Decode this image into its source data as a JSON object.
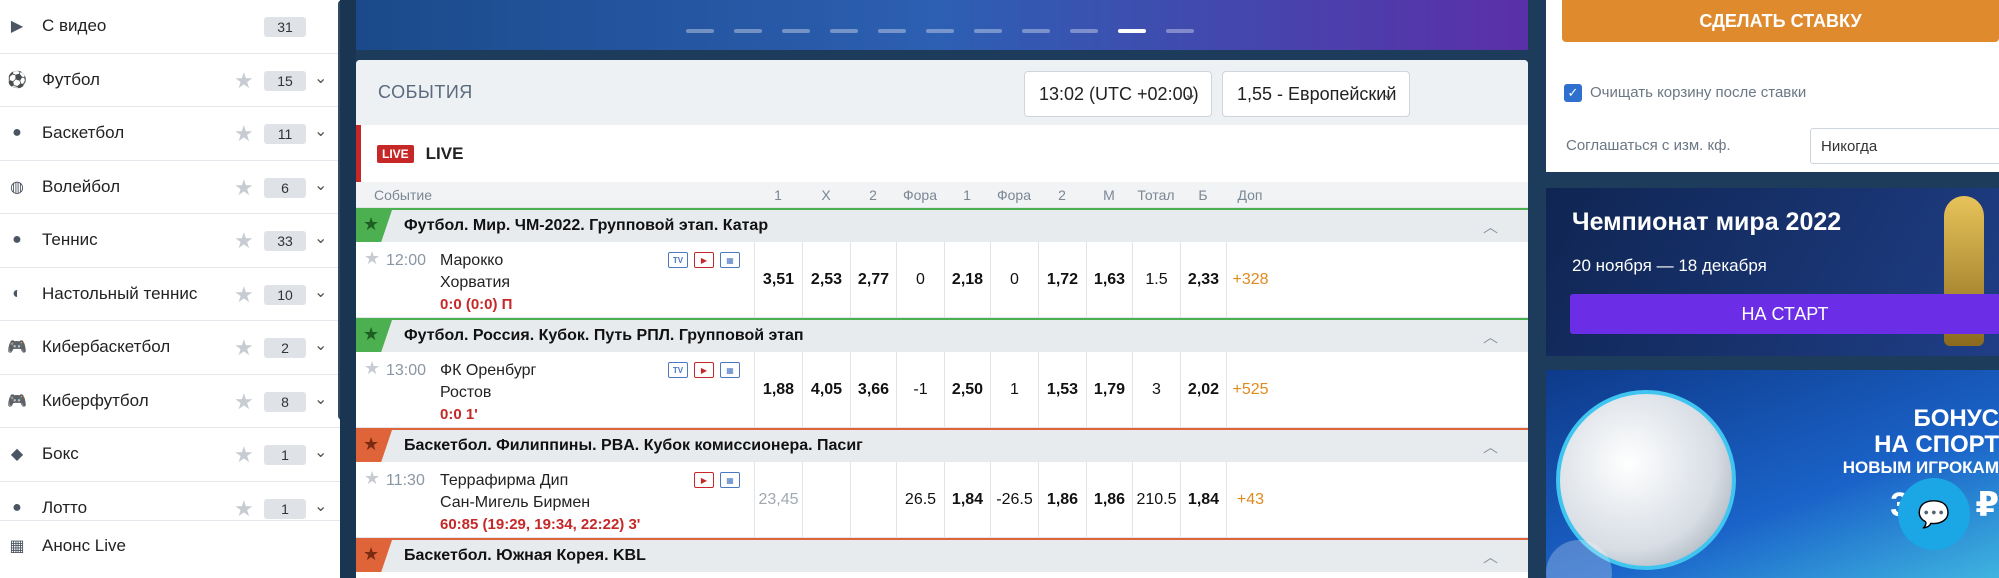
{
  "sidebar": {
    "items": [
      {
        "icon": "video-icon",
        "glyph": "▶",
        "label": "С видео",
        "count": "31",
        "star": false
      },
      {
        "icon": "football-icon",
        "glyph": "⚽",
        "label": "Футбол",
        "count": "15",
        "star": true
      },
      {
        "icon": "basketball-icon",
        "glyph": "●",
        "label": "Баскетбол",
        "count": "11",
        "star": true
      },
      {
        "icon": "volleyball-icon",
        "glyph": "◍",
        "label": "Волейбол",
        "count": "6",
        "star": true
      },
      {
        "icon": "tennis-icon",
        "glyph": "●",
        "label": "Теннис",
        "count": "33",
        "star": true
      },
      {
        "icon": "table-tennis-icon",
        "glyph": "◐",
        "label": "Настольный теннис",
        "count": "10",
        "star": true
      },
      {
        "icon": "gamepad-icon",
        "glyph": "🎮",
        "label": "Кибербаскетбол",
        "count": "2",
        "star": true
      },
      {
        "icon": "gamepad-icon",
        "glyph": "🎮",
        "label": "Киберфутбол",
        "count": "8",
        "star": true
      },
      {
        "icon": "boxing-icon",
        "glyph": "◆",
        "label": "Бокс",
        "count": "1",
        "star": true
      },
      {
        "icon": "lotto-icon",
        "glyph": "●",
        "label": "Лотто",
        "count": "1",
        "star": true
      }
    ],
    "anons": {
      "icon": "calendar-icon",
      "glyph": "▦",
      "label": "Анонс Live"
    }
  },
  "events": {
    "title": "СОБЫТИЯ",
    "time_select": "13:02 (UTC +02:00)",
    "odds_select": "1,55 - Европейский",
    "live_badge": "LIVE",
    "live_label": "LIVE",
    "columns": [
      "Событие",
      "1",
      "X",
      "2",
      "Фора",
      "1",
      "Фора",
      "2",
      "М",
      "Тотал",
      "Б",
      "Доп"
    ],
    "groups": [
      {
        "league": "Футбол. Мир. ЧМ-2022. Групповой этап. Катар",
        "color": "green",
        "match": {
          "time": "12:00",
          "team1": "Марокко",
          "team2": "Хорватия",
          "score": "0:0 (0:0) П",
          "icons": [
            "TV",
            "▶",
            "▦"
          ],
          "odds": [
            "3,51",
            "2,53",
            "2,77",
            "0",
            "2,18",
            "0",
            "1,72",
            "1,63",
            "1.5",
            "2,33",
            "+328"
          ]
        }
      },
      {
        "league": "Футбол. Россия. Кубок. Путь РПЛ. Групповой этап",
        "color": "green",
        "match": {
          "time": "13:00",
          "team1": "ФК Оренбург",
          "team2": "Ростов",
          "score": "0:0 1'",
          "icons": [
            "TV",
            "▶",
            "▦"
          ],
          "odds": [
            "1,88",
            "4,05",
            "3,66",
            "-1",
            "2,50",
            "1",
            "1,53",
            "1,79",
            "3",
            "2,02",
            "+525"
          ]
        }
      },
      {
        "league": "Баскетбол. Филиппины. PBA. Кубок комиссионера. Пасиг",
        "color": "red",
        "match": {
          "time": "11:30",
          "team1": "Террафирма Дип",
          "team2": "Сан-Мигель Бирмен",
          "score": "60:85 (19:29, 19:34, 22:22) 3'",
          "icons": [
            "▶",
            "▦"
          ],
          "odds": [
            "23,45",
            "",
            "",
            "26.5",
            "1,84",
            "-26.5",
            "1,86",
            "1,86",
            "210.5",
            "1,84",
            "+43"
          ]
        }
      },
      {
        "league": "Баскетбол. Южная Корея. KBL",
        "color": "red"
      }
    ]
  },
  "right": {
    "bet_button": "СДЕЛАТЬ СТАВКУ",
    "clear_checkbox": "Очищать корзину после ставки",
    "agree_label": "Соглашаться с изм. кф.",
    "agree_value": "Никогда",
    "wc_title": "Чемпионат мира 2022",
    "wc_dates": "20 ноября — 18 декабря",
    "wc_button": "НА СТАРТ",
    "promo_line1": "БОНУС",
    "promo_line2": "НА СПОРТ",
    "promo_line3": "НОВЫМ ИГРОКАМ",
    "promo_line4": "3000 ₽"
  },
  "banner": {
    "dots": 11,
    "active_dot": 9
  }
}
